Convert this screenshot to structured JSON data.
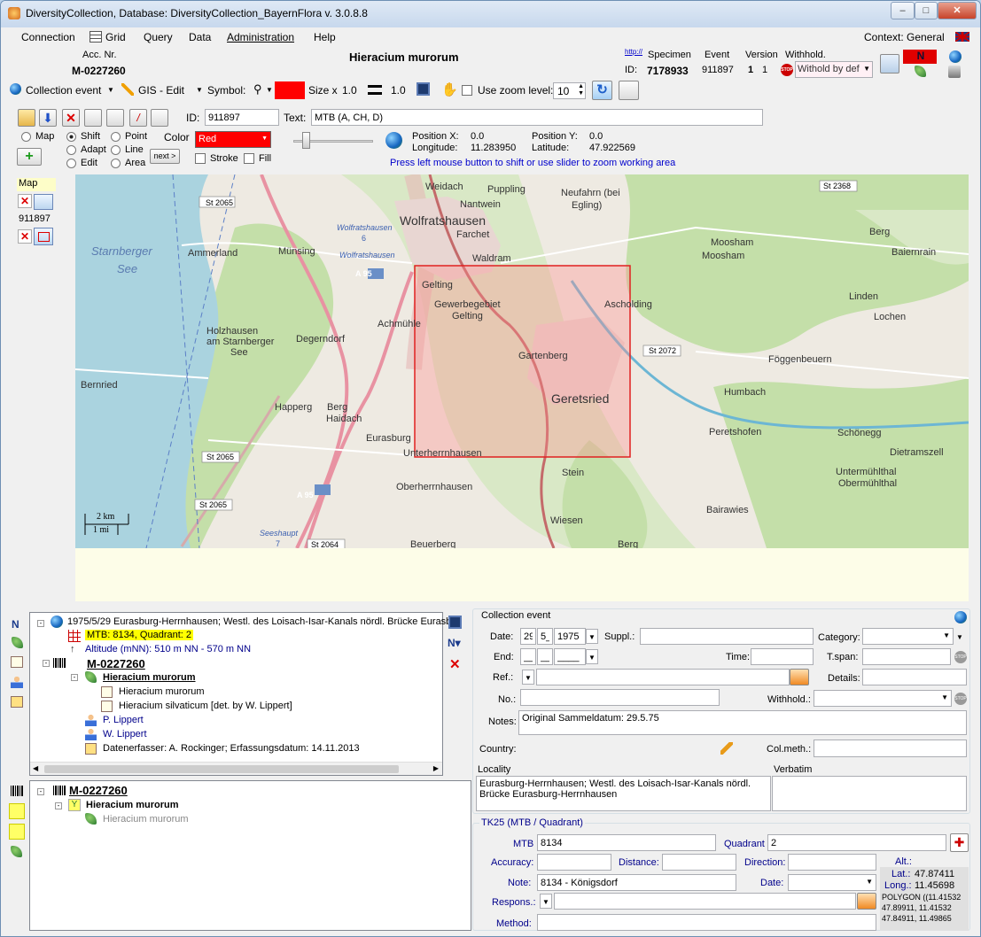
{
  "window": {
    "title": "DiversityCollection,  Database: DiversityCollection_BayernFlora    v. 3.0.8.8"
  },
  "menu": {
    "connection": "Connection",
    "grid": "Grid",
    "query": "Query",
    "data": "Data",
    "administration": "Administration",
    "help": "Help",
    "context": "Context: General"
  },
  "header": {
    "acc_label": "Acc. Nr.",
    "acc_value": "M-0227260",
    "taxon": "Hieracium murorum",
    "http": "http://",
    "id_label": "ID:",
    "specimen_label": "Specimen",
    "specimen_id": "7178933",
    "event_label": "Event",
    "event_id": "911897",
    "version_label": "Version",
    "version_a": "1",
    "version_b": "1",
    "withhold_label": "Withhold.",
    "withhold_value": "Withold by def",
    "stop": "STOP"
  },
  "toolbar2": {
    "collection_event": "Collection event",
    "gis_edit": "GIS - Edit",
    "symbol": "Symbol:",
    "size_label": "Size x",
    "size_value": "1.0",
    "line_value": "1.0",
    "zoom_label": "Use zoom level:",
    "zoom_value": "10"
  },
  "gis": {
    "id_label": "ID:",
    "id_value": "911897",
    "text_label": "Text:",
    "text_value": "MTB (A, CH, D)",
    "radio_map": "Map",
    "radio_shift": "Shift",
    "radio_point": "Point",
    "radio_adapt": "Adapt",
    "radio_line": "Line",
    "radio_edit": "Edit",
    "radio_area": "Area",
    "color_label": "Color",
    "color_value": "Red",
    "next": "next >",
    "stroke": "Stroke",
    "fill": "Fill",
    "posx_label": "Position X:",
    "posx_value": "0.0",
    "posy_label": "Position Y:",
    "posy_value": "0.0",
    "lon_label": "Longitude:",
    "lon_value": "11.283950",
    "lat_label": "Latitude:",
    "lat_value": "47.922569",
    "hint": "Press left mouse button to shift or use slider to zoom working area"
  },
  "side": {
    "map": "Map",
    "id": "911897"
  },
  "map": {
    "labels": [
      "Weidach",
      "Puppling",
      "Neufahrn (bei",
      "Egling)",
      "Nantwein",
      "Wolfratshausen",
      "Farchet",
      "Waldram",
      "St 2065",
      "St 2368",
      "Starnberger",
      "See",
      "Ammerland",
      "Münsing",
      "Wolfratshausen",
      "Wolfratshausen",
      "A 95",
      "Gelting",
      "Gewerbegebiet",
      "Gelting",
      "Moosham",
      "Moosham",
      "Berg",
      "Baiernrain",
      "Linden",
      "Lochen",
      "Asc­holding",
      "Holzhausen",
      "am Starnberger",
      "See",
      "Degerndorf",
      "Achmühle",
      "Gartenberg",
      "St 2072",
      "Föggenbeuern",
      "Bernried",
      "Happerg",
      "Berg",
      "Haidach",
      "Geretsried",
      "Humbach",
      "Peretshofen",
      "Schönegg",
      "Eurasburg",
      "Unterherrnhausen",
      "St 2065",
      "Untermühlthal",
      "Obermühlthal",
      "Dietramszell",
      "Stein",
      "A 95",
      "St 2065",
      "Oberherrnhausen",
      "Bairawies",
      "Wiesen",
      "Seeshaupt",
      "St 2064",
      "Beuerberg",
      "Berg",
      "6",
      "7"
    ],
    "scale_km": "2 km",
    "scale_mi": "1 mi"
  },
  "tree1": {
    "event": "1975/5/29 Eurasburg-Herrnhausen; Westl. des Loisach-Isar-Kanals nördl. Brücke Eurasb",
    "mtb": "MTB: 8134, Quadrant: 2",
    "altitude": "Altitude (mNN): 510 m NN - 570 m NN",
    "specimen": "M-0227260",
    "taxon": "Hieracium murorum",
    "ident1": "Hieracium murorum",
    "ident2": "Hieracium silvaticum   [det. by W. Lippert]",
    "collector1": "P. Lippert",
    "collector2": "W. Lippert",
    "note": "Datenerfasser: A. Rockinger; Erfassungsdatum: 14.11.2013"
  },
  "tree2": {
    "specimen": "M-0227260",
    "taxon": "Hieracium murorum",
    "taxon_grey": "Hieracium murorum"
  },
  "event_form": {
    "group": "Collection event",
    "date_label": "Date:",
    "date_d": "29",
    "date_m": "5_",
    "date_y": "1975",
    "suppl_label": "Suppl.:",
    "category_label": "Category:",
    "end_label": "End:",
    "end_d": "__",
    "end_m": "__",
    "end_y": "____",
    "time_label": "Time:",
    "tspan_label": "T.span:",
    "ref_label": "Ref.:",
    "details_label": "Details:",
    "no_label": "No.:",
    "withhold_label": "Withhold.:",
    "notes_label": "Notes:",
    "notes_value": "Original Sammeldatum: 29.5.75",
    "country_label": "Country:",
    "colmeth_label": "Col.meth.:",
    "locality_label": "Locality",
    "verbatim_label": "Verbatim",
    "locality_value": "Eurasburg-Herrnhausen; Westl. des Loisach-Isar-Kanals nördl. Brücke Eurasburg-Herrnhausen"
  },
  "tk25": {
    "group": "TK25 (MTB / Quadrant)",
    "mtb_label": "MTB",
    "mtb_value": "8134",
    "quadrant_label": "Quadrant",
    "quadrant_value": "2",
    "accuracy_label": "Accuracy:",
    "distance_label": "Distance:",
    "direction_label": "Direction:",
    "alt_label": "Alt.:",
    "lat_label": "Lat.:",
    "lat_value": "47.87411",
    "long_label": "Long.:",
    "long_value": "11.45698",
    "note_label": "Note:",
    "note_value": "8134 - Königsdorf",
    "date_label": "Date:",
    "respons_label": "Respons.:",
    "method_label": "Method:",
    "polygon1": "POLYGON ((11.41532",
    "polygon2": "47.89911, 11.41532",
    "polygon3": "47.84911, 11.49865"
  }
}
